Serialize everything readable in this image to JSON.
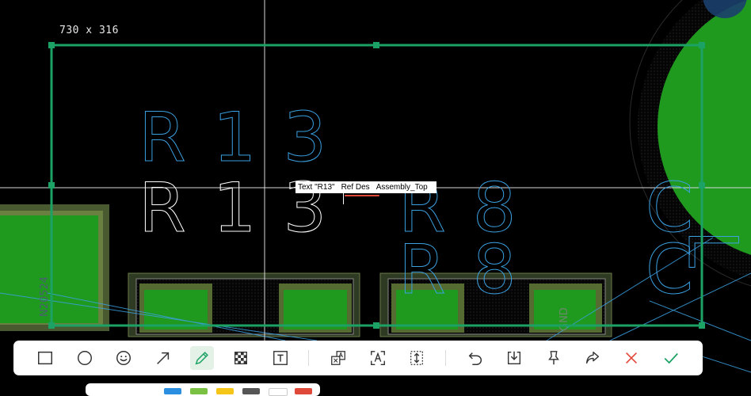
{
  "selection": {
    "size_text": "730 x 316"
  },
  "pcb": {
    "ref_labels": [
      "R13",
      "R13",
      "R8",
      "R8"
    ],
    "side_labels": [
      "N20524",
      "GND"
    ],
    "silk_letters": [
      "C",
      "C",
      "L"
    ]
  },
  "tooltip": {
    "parts": [
      "Text \"R13\"",
      "Ref Des",
      "Assembly_Top"
    ]
  },
  "toolbar": {
    "tools": [
      {
        "name": "rectangle-tool",
        "icon": "rectangle-icon"
      },
      {
        "name": "ellipse-tool",
        "icon": "circle-icon"
      },
      {
        "name": "emoji-tool",
        "icon": "smiley-icon"
      },
      {
        "name": "arrow-tool",
        "icon": "arrow-icon"
      },
      {
        "name": "pen-tool",
        "icon": "pencil-icon",
        "active": true
      },
      {
        "name": "mosaic-tool",
        "icon": "mosaic-icon"
      },
      {
        "name": "text-tool",
        "icon": "text-icon"
      },
      {
        "name": "translate-tool",
        "icon": "translate-icon"
      },
      {
        "name": "ocr-tool",
        "icon": "ocr-icon"
      },
      {
        "name": "scroll-capture-tool",
        "icon": "scroll-icon"
      },
      {
        "name": "undo-tool",
        "icon": "undo-icon"
      },
      {
        "name": "save-tool",
        "icon": "download-icon"
      },
      {
        "name": "pin-tool",
        "icon": "pin-icon"
      },
      {
        "name": "share-tool",
        "icon": "share-icon"
      },
      {
        "name": "cancel-tool",
        "icon": "close-icon"
      },
      {
        "name": "confirm-tool",
        "icon": "check-icon"
      }
    ]
  },
  "colors": {
    "accent": "#1ba264",
    "cancel": "#e0483a",
    "pad_green": "#1f9a1f",
    "silk_blue": "#3aa0e0",
    "swatches": [
      "#2a8fe0",
      "#7ac143",
      "#f5c518",
      "#555555",
      "#ffffff",
      "#e0483a"
    ]
  }
}
